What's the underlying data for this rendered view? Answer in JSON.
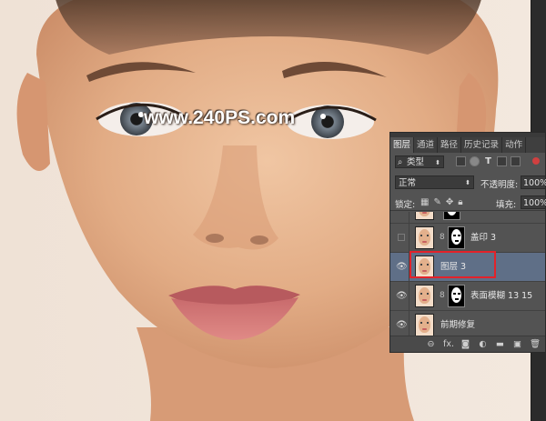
{
  "watermark": "www.240PS.com",
  "panel": {
    "tabs": [
      "图层",
      "通道",
      "路径",
      "历史记录",
      "动作"
    ],
    "kind_filter": "类型",
    "blend_mode": "正常",
    "opacity_label": "不透明度:",
    "opacity_value": "100%",
    "lock_label": "锁定:",
    "fill_label": "填充:",
    "fill_value": "100%",
    "layers": [
      {
        "name": "",
        "visible": false
      },
      {
        "name": "盖印 3",
        "visible": false
      },
      {
        "name": "图层 3",
        "visible": true,
        "selected": true
      },
      {
        "name": "表面模糊 13 15",
        "visible": true
      },
      {
        "name": "前期修复",
        "visible": true
      }
    ],
    "bottom_icons": [
      "link-icon",
      "fx-icon",
      "mask-icon",
      "adjustment-icon",
      "folder-icon",
      "new-layer-icon",
      "trash-icon"
    ],
    "bottom_fx_label": "fx."
  },
  "colors": {
    "panel_bg": "#535353",
    "selected_layer": "#5f6f87",
    "highlight_red": "#e3222a"
  }
}
